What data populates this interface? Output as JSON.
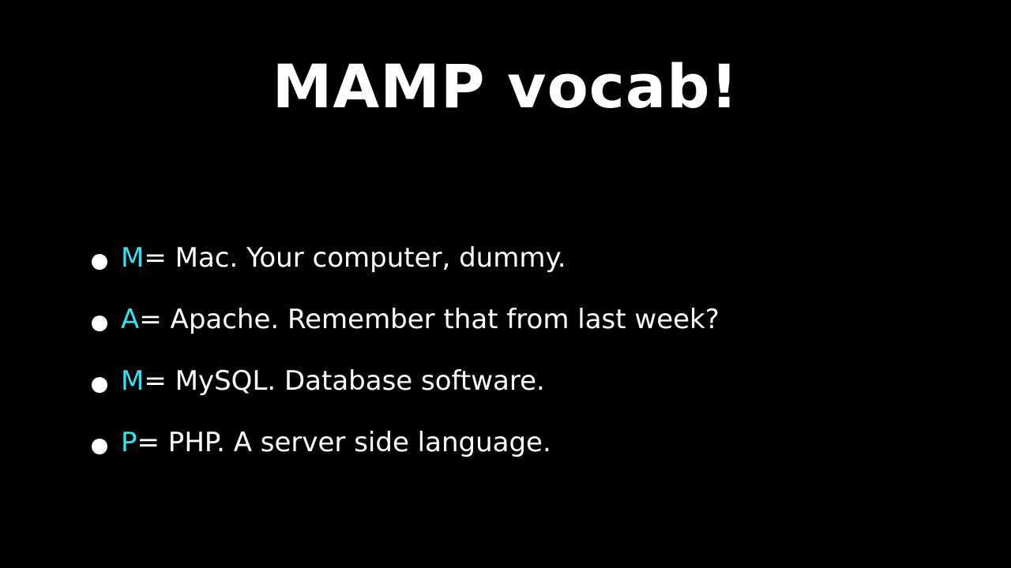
{
  "slide": {
    "title": "MAMP vocab!",
    "colors": {
      "background": "#000000",
      "text": "#ffffff",
      "accent": "#33e1ef"
    },
    "bullets": [
      {
        "letter": "M",
        "text": " = Mac. Your computer, dummy."
      },
      {
        "letter": "A",
        "text": " = Apache. Remember that from last week?"
      },
      {
        "letter": "M",
        "text": " = MySQL. Database software."
      },
      {
        "letter": "P",
        "text": " = PHP. A server side language."
      }
    ]
  }
}
